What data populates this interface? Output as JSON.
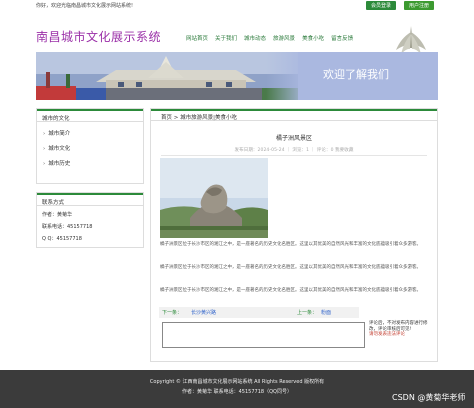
{
  "topbar": {
    "greeting": "你好，欢迎光临南昌城市文化展示网站系统!",
    "login": "会员登录",
    "register": "用户注册"
  },
  "header": {
    "site_name": "南昌城市文化展示系统"
  },
  "nav": [
    "网站首页",
    "关于我们",
    "城市动态",
    "旅游风景",
    "美食小吃",
    "留言反馈"
  ],
  "banner": {
    "text": "欢迎了解我们"
  },
  "sidebar": {
    "title": "城市的文化",
    "items": [
      "城市简介",
      "城市文化",
      "城市历史"
    ],
    "contact_title": "联系方式",
    "contact": [
      "作者：黄菊华",
      "联系电话：45157718",
      "Q Q：45157718"
    ]
  },
  "article": {
    "breadcrumb": "首页 > 城市旅游风景|美食小吃",
    "title": "橘子洲风景区",
    "meta": "发布日期：2024-05-24 ｜ 浏览：1 ｜ 评论：0 我要收藏",
    "paragraphs": [
      "橘子洲景区位于长沙市区的湘江之中，是一座著名的历史文化名胜区。这里以其优美的自然风光和丰富的文化底蕴吸引着众多游客。",
      "橘子洲景区位于长沙市区的湘江之中，是一座著名的历史文化名胜区。这里以其优美的自然风光和丰富的文化底蕴吸引着众多游客。",
      "橘子洲景区位于长沙市区的湘江之中，是一座著名的历史文化名胜区。这里以其优美的自然风光和丰富的文化底蕴吸引着众多游客。"
    ],
    "prev_label": "下一条：",
    "prev_link": "长沙黄兴路",
    "next_label": "上一条：",
    "next_link": "粉面",
    "comment_note": "评论后，不对发布内容进行修改，评论审核后可见!",
    "comment_warn": "请勿发表违法评论"
  },
  "footer": {
    "line1": "Copyright © 江西南昌城市文化展示网站系统     All Rights Reserved 版权所有",
    "line2": "作者：黄菊华     联系电话：45157718（QQ同号）"
  },
  "watermark": "CSDN @黄菊华老师",
  "colors": {
    "green": "#2c8a3a",
    "purple": "#9b30a8",
    "banner_blue": "#aab8e0",
    "footer": "#3b3b3b"
  }
}
